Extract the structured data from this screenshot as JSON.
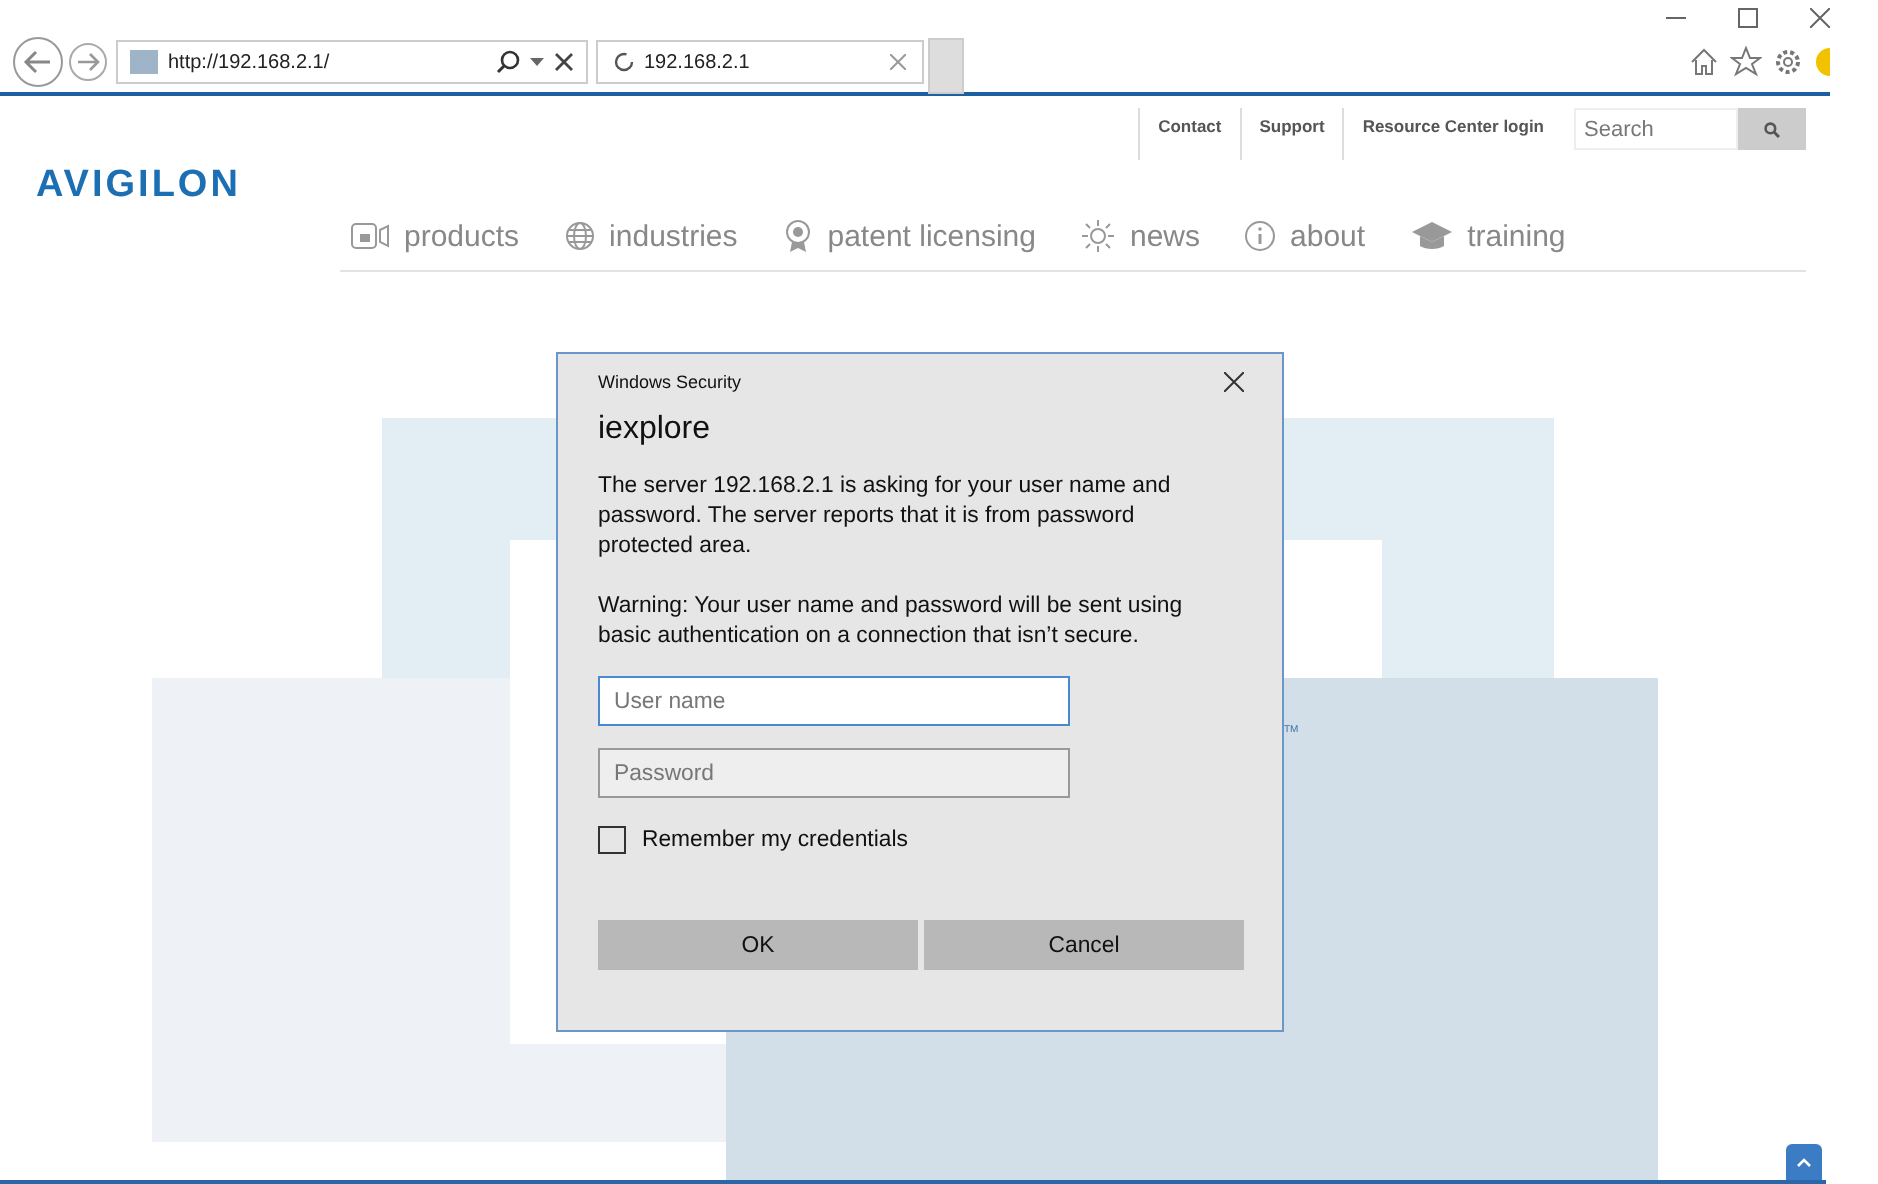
{
  "browser": {
    "address": "http://192.168.2.1/",
    "tab": {
      "title": "192.168.2.1",
      "selected": true
    }
  },
  "site": {
    "logo": "AVIGILON",
    "top_links": [
      "Contact",
      "Support",
      "Resource Center login"
    ],
    "search": {
      "placeholder": "Search"
    },
    "nav": [
      {
        "label": "products"
      },
      {
        "label": "industries"
      },
      {
        "label": "patent licensing"
      },
      {
        "label": "news"
      },
      {
        "label": "about"
      },
      {
        "label": "training"
      }
    ],
    "trademark": "TM"
  },
  "dialog": {
    "app": "Windows Security",
    "title": "iexplore",
    "message": "The server 192.168.2.1 is asking for your user name and password. The server reports that it is from password protected area.",
    "warning": "Warning: Your user name and password will be sent using basic authentication on a connection that isn’t secure.",
    "fields": [
      {
        "placeholder": "User name",
        "focused": true
      },
      {
        "placeholder": "Password",
        "focused": false
      }
    ],
    "remember": {
      "label": "Remember my credentials",
      "checked": false
    },
    "buttons": [
      "OK",
      "Cancel"
    ]
  }
}
